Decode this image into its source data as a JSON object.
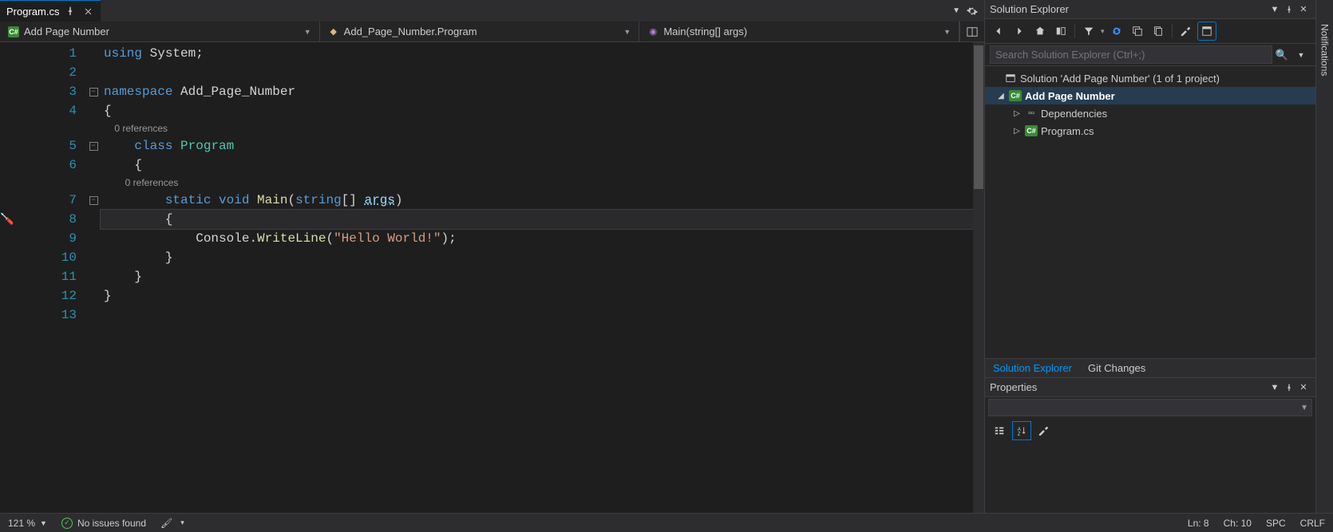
{
  "tab": {
    "filename": "Program.cs"
  },
  "breadcrumbs": {
    "scope1": "Add Page Number",
    "scope2": "Add_Page_Number.Program",
    "scope3": "Main(string[] args)"
  },
  "codelens": {
    "class_refs": "0 references",
    "method_refs": "0 references"
  },
  "code": {
    "line1_using": "using",
    "line1_system": "System",
    "line3_ns": "namespace",
    "line3_name": "Add_Page_Number",
    "line5_class": "class",
    "line5_name": "Program",
    "line7_static": "static",
    "line7_void": "void",
    "line7_main": "Main",
    "line7_string": "string",
    "line7_args": "args",
    "line9_console": "Console",
    "line9_wl": "WriteLine",
    "line9_str": "\"Hello World!\""
  },
  "line_numbers": [
    "1",
    "2",
    "3",
    "4",
    "5",
    "6",
    "7",
    "8",
    "9",
    "10",
    "11",
    "12",
    "13"
  ],
  "solution_explorer": {
    "title": "Solution Explorer",
    "search_placeholder": "Search Solution Explorer (Ctrl+;)",
    "solution": "Solution 'Add Page Number' (1 of 1 project)",
    "project": "Add Page Number",
    "dependencies": "Dependencies",
    "file1": "Program.cs",
    "tabs": {
      "se": "Solution Explorer",
      "git": "Git Changes"
    }
  },
  "properties": {
    "title": "Properties"
  },
  "notifications": {
    "label": "Notifications"
  },
  "status": {
    "zoom": "121 %",
    "issues": "No issues found",
    "ln": "Ln: 8",
    "ch": "Ch: 10",
    "spc": "SPC",
    "crlf": "CRLF"
  }
}
